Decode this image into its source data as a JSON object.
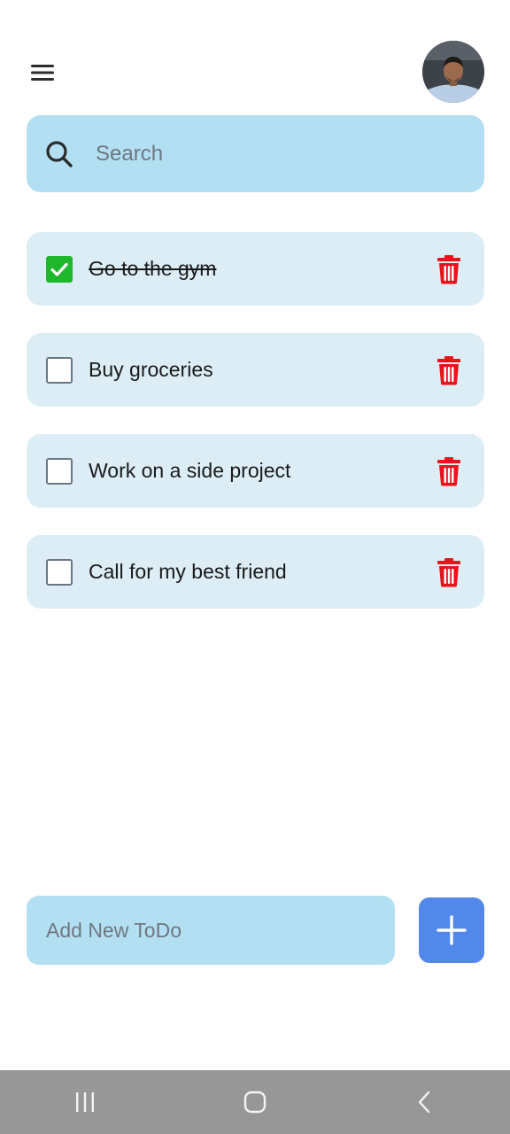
{
  "header": {
    "menu_icon": "hamburger-menu-icon",
    "avatar_icon": "user-avatar"
  },
  "search": {
    "placeholder": "Search",
    "value": "",
    "icon": "search-icon"
  },
  "todos": [
    {
      "text": "Go to the gym",
      "done": true
    },
    {
      "text": "Buy groceries",
      "done": false
    },
    {
      "text": "Work on a side project",
      "done": false
    },
    {
      "text": "Call for my best friend",
      "done": false
    }
  ],
  "add_todo": {
    "placeholder": "Add New ToDo",
    "value": "",
    "button_icon": "plus-icon"
  },
  "colors": {
    "search_bg": "#b3dff3",
    "item_bg": "#dcedf6",
    "checked": "#1fb82c",
    "delete": "#e8131b",
    "add_button": "#5288ea",
    "nav_bar": "#979797"
  },
  "system_nav": {
    "items": [
      "recent-apps-icon",
      "home-icon",
      "back-icon"
    ]
  }
}
